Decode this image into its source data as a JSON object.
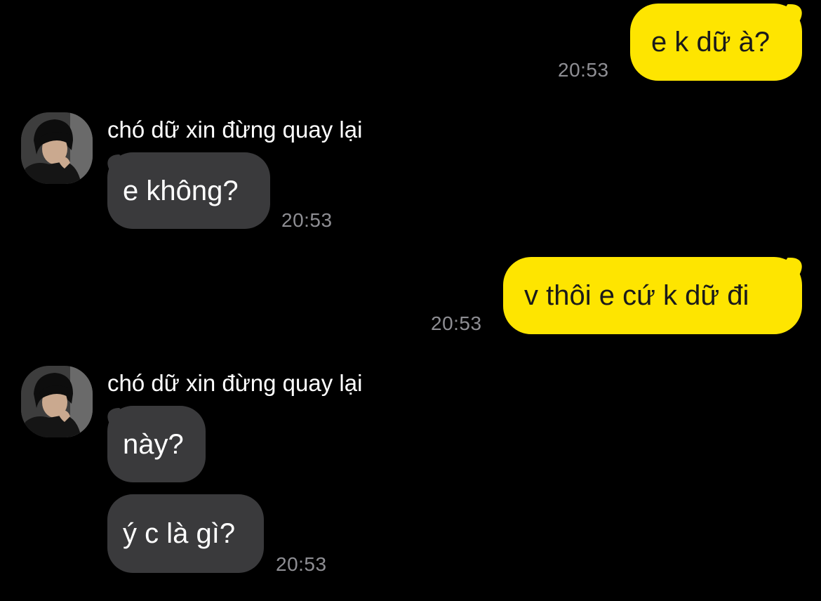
{
  "messages": [
    {
      "direction": "out",
      "text": "e k dữ à?",
      "time": "20:53"
    },
    {
      "direction": "in",
      "sender": "chó dữ xin đừng quay lại",
      "text": "e không?",
      "time": "20:53"
    },
    {
      "direction": "out",
      "text": "v thôi e cứ k dữ đi",
      "time": "20:53"
    },
    {
      "direction": "in",
      "sender": "chó dữ xin đừng quay lại",
      "text": "này?",
      "time": ""
    },
    {
      "direction": "in",
      "text": "ý c là gì?",
      "time": "20:53"
    }
  ],
  "colors": {
    "background": "#000000",
    "outgoing_bubble": "#FEE500",
    "incoming_bubble": "#3a3a3c",
    "timestamp": "#8e8e93"
  },
  "icons": {
    "avatar": "profile-photo"
  }
}
